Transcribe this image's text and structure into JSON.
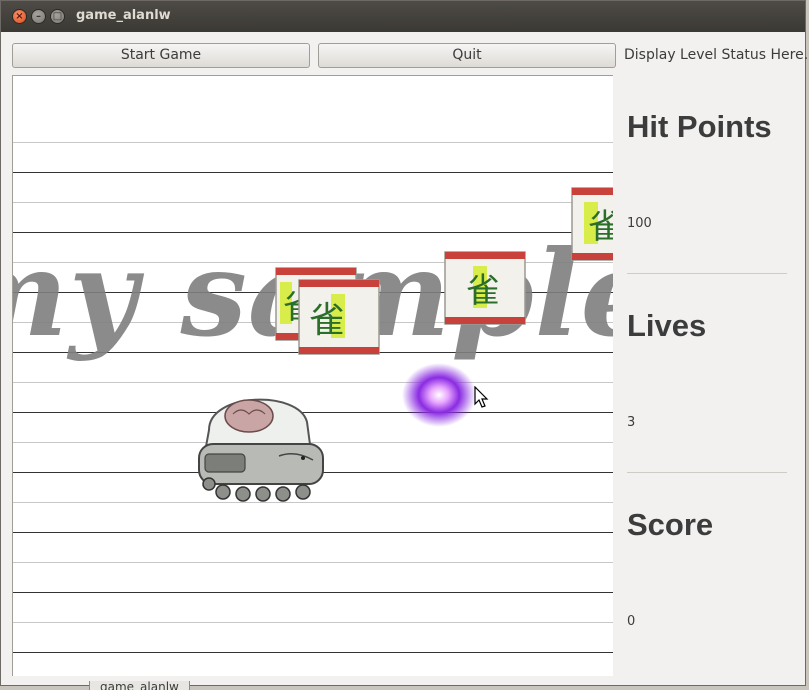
{
  "window": {
    "title": "game_alanlw"
  },
  "toolbar": {
    "start_label": "Start Game",
    "quit_label": "Quit",
    "level_status": "Display Level Status Here."
  },
  "stats": {
    "hit_points_label": "Hit Points",
    "hit_points": "100",
    "lives_label": "Lives",
    "lives": "3",
    "score_label": "Score",
    "score": "0"
  },
  "game": {
    "watermark": "my sample",
    "tile_character": "雀",
    "enemy_count": 4,
    "sprites": [
      "player-tank",
      "mahjong-tile-enemy",
      "purple-energy-orb",
      "mouse-cursor"
    ]
  },
  "taskbar": {
    "item_label": "game_alanlw"
  },
  "colors": {
    "titlebar": "#3c3b37",
    "window_bg": "#f2f1f0",
    "orb": "#8a2be2",
    "tile_red": "#c8413a",
    "tile_green": "#c9e23a"
  }
}
